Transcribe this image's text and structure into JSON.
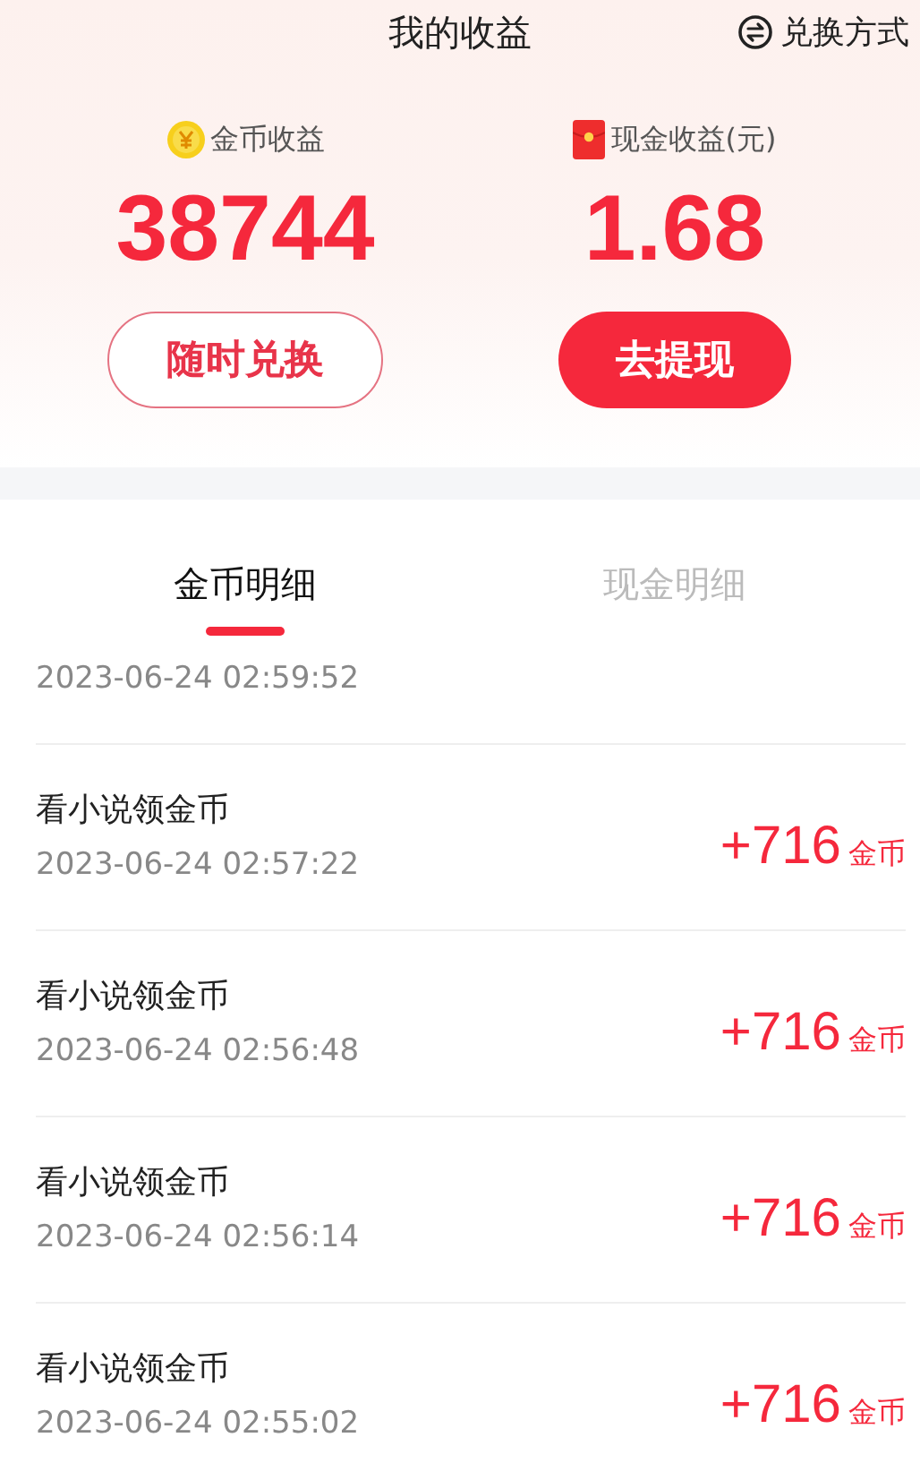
{
  "header": {
    "title": "我的收益",
    "action": "兑换方式"
  },
  "balances": [
    {
      "kind": "coin",
      "label": "金币收益",
      "value": "38744",
      "button": "随时兑换"
    },
    {
      "kind": "cash",
      "label": "现金收益(元)",
      "value": "1.68",
      "button": "去提现"
    }
  ],
  "tabs": [
    {
      "label": "金币明细",
      "selected": true
    },
    {
      "label": "现金明细",
      "selected": false
    }
  ],
  "records": [
    {
      "time": "2023-06-24 02:59:52"
    },
    {
      "title": "看小说领金币",
      "time": "2023-06-24 02:57:22",
      "amount": "+716",
      "unit": "金币"
    },
    {
      "title": "看小说领金币",
      "time": "2023-06-24 02:56:48",
      "amount": "+716",
      "unit": "金币"
    },
    {
      "title": "看小说领金币",
      "time": "2023-06-24 02:56:14",
      "amount": "+716",
      "unit": "金币"
    },
    {
      "title": "看小说领金币",
      "time": "2023-06-24 02:55:02",
      "amount": "+716",
      "unit": "金币"
    }
  ]
}
